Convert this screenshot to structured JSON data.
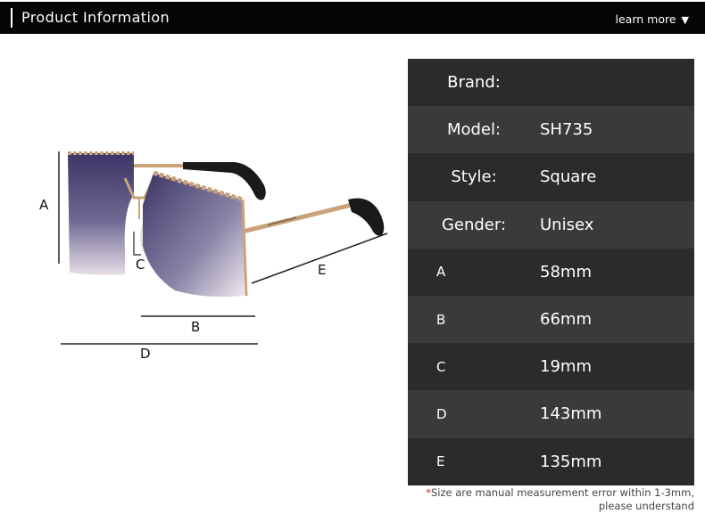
{
  "header": {
    "title": "Product Information",
    "more_label": "learn more",
    "more_arrow": "▼"
  },
  "diagram": {
    "labels": {
      "a": "A",
      "b": "B",
      "c": "C",
      "d": "D",
      "e": "E"
    },
    "lens_color": "#5b5480",
    "frame_color": "#c9a27a"
  },
  "specs": [
    {
      "label": "Brand:",
      "value": ""
    },
    {
      "label": "Model:",
      "value": "SH735"
    },
    {
      "label": "Style:",
      "value": "Square"
    },
    {
      "label": "Gender:",
      "value": "Unisex"
    },
    {
      "label": "A",
      "value": "58mm"
    },
    {
      "label": "B",
      "value": "66mm"
    },
    {
      "label": "C",
      "value": "19mm"
    },
    {
      "label": "D",
      "value": "143mm"
    },
    {
      "label": "E",
      "value": "135mm"
    }
  ],
  "note": {
    "star": "*",
    "line1": "Size are manual measurement error within 1-3mm,",
    "line2": "please understand"
  }
}
